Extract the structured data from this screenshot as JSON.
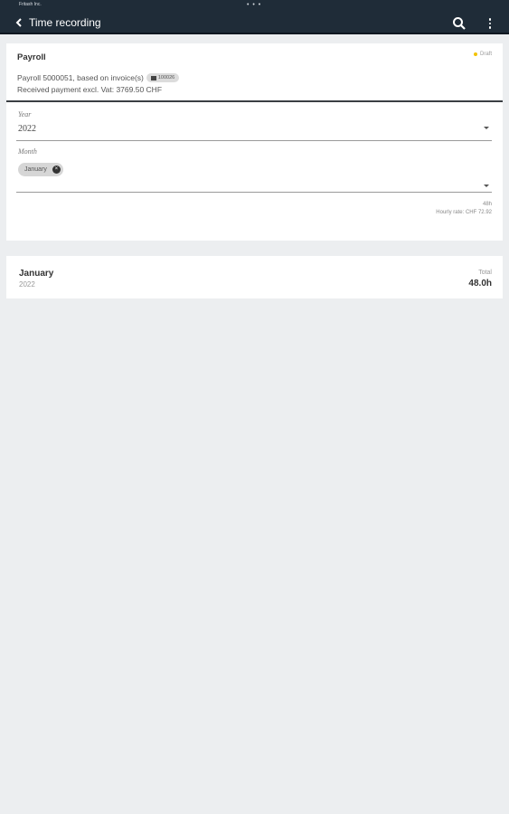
{
  "status": {
    "time": "Fritash Inc.",
    "dots": "• • •"
  },
  "header": {
    "title": "Time recording"
  },
  "payroll": {
    "title": "Payroll",
    "status": "Draft",
    "description_prefix": "Payroll 5000051, based on invoice(s)",
    "invoice_chip": "100026",
    "received": "Received payment excl. Vat: 3769.50 CHF",
    "year_label": "Year",
    "year_value": "2022",
    "month_label": "Month",
    "month_chip": "January",
    "hours": "48h",
    "hourly_rate": "Hourly rate: CHF 72.92"
  },
  "summary": {
    "month": "January",
    "year": "2022",
    "total_label": "Total",
    "total_value": "48.0h"
  },
  "colors": {
    "topbar": "#1f2c38",
    "background": "#eceef0",
    "draft_dot": "#f2c200"
  }
}
